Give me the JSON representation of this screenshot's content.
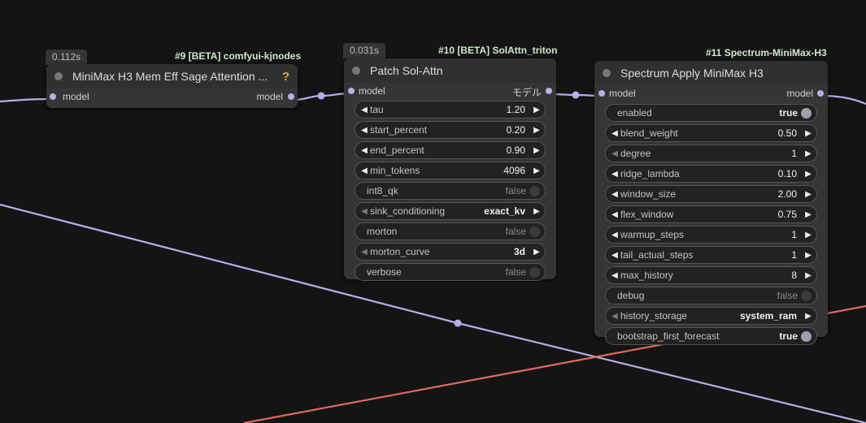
{
  "theme": {
    "canvas_bg": "#141414",
    "node_bg": "#353535",
    "wire_model": "#b8acea",
    "wire_other": "#e26a5e",
    "help_color": "#e0a82e"
  },
  "nodes": [
    {
      "badge": "0.112s",
      "source": "#9 [BETA] comfyui-kjnodes",
      "title": "MiniMax H3 Mem Eff Sage Attention ...",
      "help_icon": "?",
      "input_label": "model",
      "output_label": "model",
      "widgets": []
    },
    {
      "badge": "0.031s",
      "source": "#10 [BETA] SolAttn_triton",
      "title": "Patch Sol-Attn",
      "input_label": "model",
      "output_label": "モデル",
      "widgets": [
        {
          "type": "number",
          "label": "tau",
          "value": "1.20"
        },
        {
          "type": "number",
          "label": "start_percent",
          "value": "0.20"
        },
        {
          "type": "number",
          "label": "end_percent",
          "value": "0.90"
        },
        {
          "type": "number",
          "label": "min_tokens",
          "value": "4096"
        },
        {
          "type": "toggle",
          "label": "int8_qk",
          "value": "false",
          "on": false
        },
        {
          "type": "combo",
          "label": "sink_conditioning",
          "value": "exact_kv"
        },
        {
          "type": "toggle",
          "label": "morton",
          "value": "false",
          "on": false
        },
        {
          "type": "combo",
          "label": "morton_curve",
          "value": "3d"
        },
        {
          "type": "toggle",
          "label": "verbose",
          "value": "false",
          "on": false
        }
      ]
    },
    {
      "source": "#11 Spectrum-MiniMax-H3",
      "title": "Spectrum Apply MiniMax H3",
      "input_label": "model",
      "output_label": "model",
      "widgets": [
        {
          "type": "toggle",
          "label": "enabled",
          "value": "true",
          "on": true
        },
        {
          "type": "number",
          "label": "blend_weight",
          "value": "0.50"
        },
        {
          "type": "combo",
          "label": "degree",
          "value": "1"
        },
        {
          "type": "number",
          "label": "ridge_lambda",
          "value": "0.10"
        },
        {
          "type": "number",
          "label": "window_size",
          "value": "2.00"
        },
        {
          "type": "number",
          "label": "flex_window",
          "value": "0.75"
        },
        {
          "type": "number",
          "label": "warmup_steps",
          "value": "1"
        },
        {
          "type": "number",
          "label": "tail_actual_steps",
          "value": "1"
        },
        {
          "type": "number",
          "label": "max_history",
          "value": "8"
        },
        {
          "type": "toggle",
          "label": "debug",
          "value": "false",
          "on": false
        },
        {
          "type": "combo",
          "label": "history_storage",
          "value": "system_ram"
        },
        {
          "type": "toggle",
          "label": "bootstrap_first_forecast",
          "value": "true",
          "on": true
        }
      ]
    }
  ]
}
